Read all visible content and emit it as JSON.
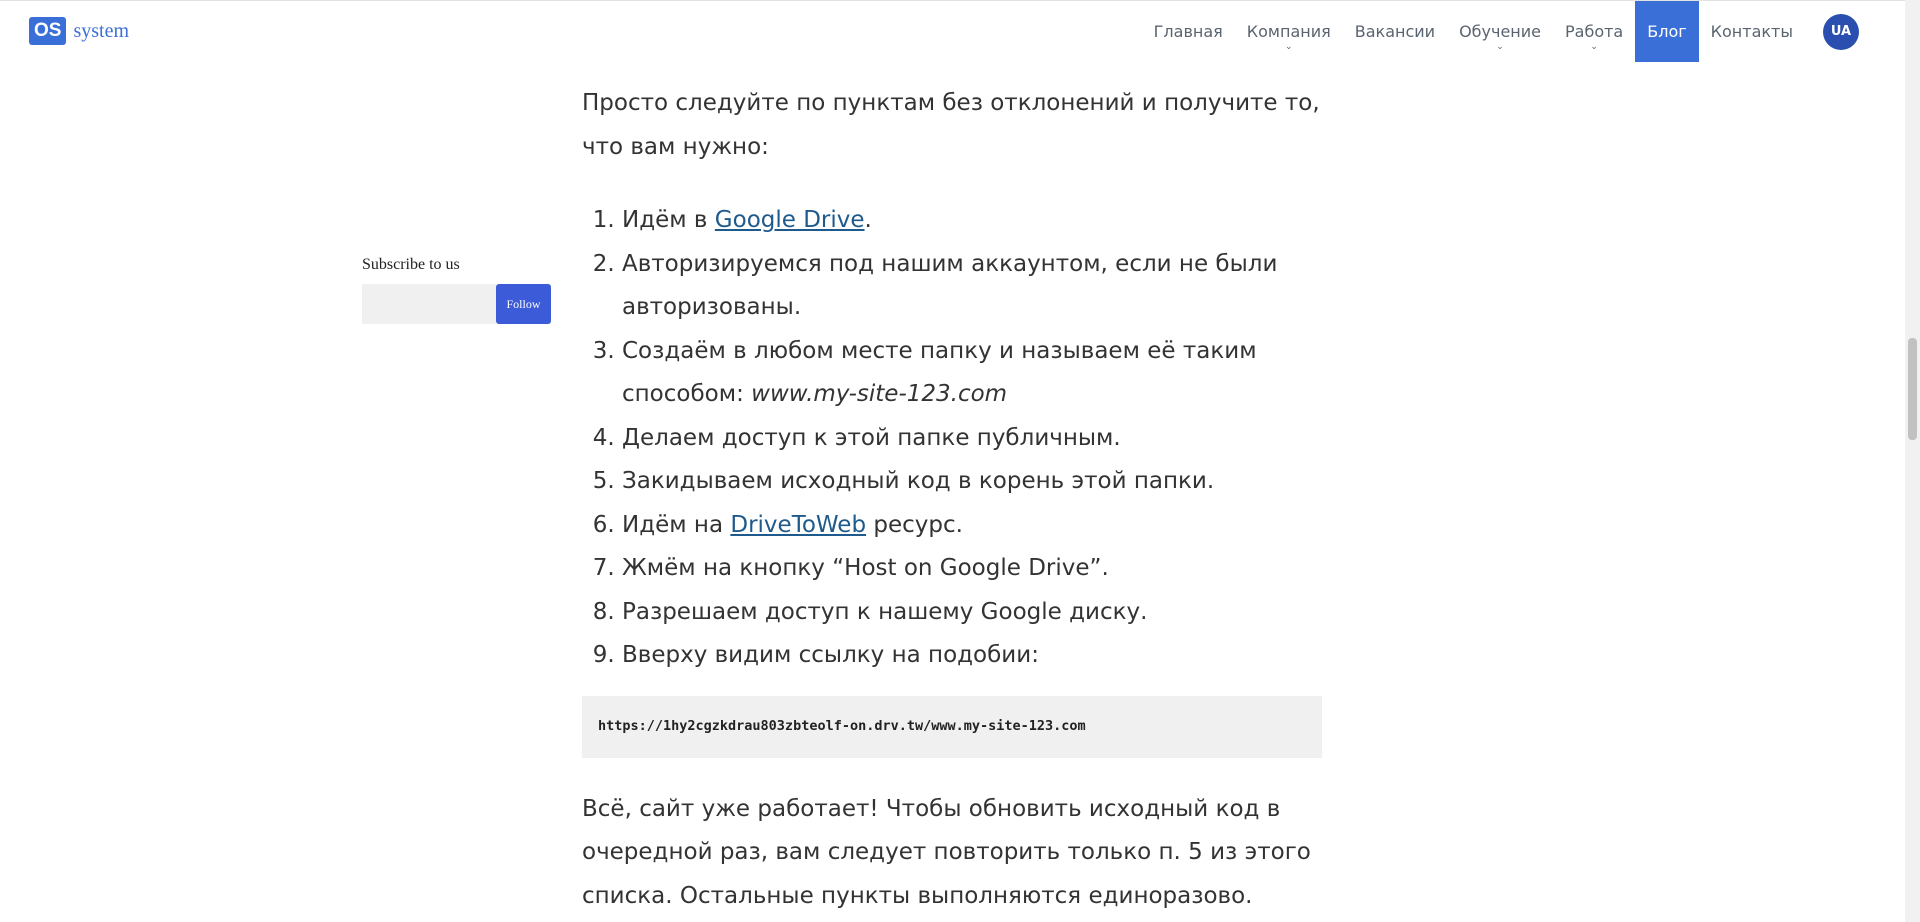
{
  "header": {
    "logo_badge": "OS",
    "logo_text": "system",
    "nav": [
      {
        "label": "Главная",
        "has_dropdown": false,
        "active": false
      },
      {
        "label": "Компания",
        "has_dropdown": true,
        "active": false
      },
      {
        "label": "Вакансии",
        "has_dropdown": false,
        "active": false
      },
      {
        "label": "Обучение",
        "has_dropdown": true,
        "active": false
      },
      {
        "label": "Работа",
        "has_dropdown": true,
        "active": false
      },
      {
        "label": "Блог",
        "has_dropdown": false,
        "active": true
      },
      {
        "label": "Контакты",
        "has_dropdown": false,
        "active": false
      }
    ],
    "language": "UA",
    "chevron_icon": "chevron-down-icon"
  },
  "sidebar": {
    "subscribe_title": "Subscribe to us",
    "subscribe_placeholder": "",
    "follow_label": "Follow"
  },
  "article": {
    "intro": "Просто следуйте по пунктам без отклонений и получите то, что вам нужно:",
    "steps": {
      "s1_before": "Идём в ",
      "s1_link": "Google Drive",
      "s1_after": ".",
      "s2": "Авторизируемся под нашим аккаунтом, если не были авторизованы.",
      "s3_before": "Создаём в любом месте папку и называем её таким способом: ",
      "s3_em": "www.my-site-123.com",
      "s4": "Делаем доступ к этой папке публичным.",
      "s5": "Закидываем исходный код в корень этой папки.",
      "s6_before": "Идём на ",
      "s6_link": "DriveToWeb",
      "s6_after": " ресурс.",
      "s7": "Жмём на кнопку “Host on Google Drive”.",
      "s8": "Разрешаем доступ к нашему Google диску.",
      "s9": "Вверху видим ссылку на подобии:"
    },
    "code": "https://1hy2cgzkdrau803zbteolf-on.drv.tw/www.my-site-123.com",
    "outro": "Всё, сайт уже работает! Чтобы обновить исходный код в очередной раз, вам следует повторить только п. 5 из этого списка. Остальные пункты выполняются единоразово."
  },
  "colors": {
    "brand": "#3b6fd8",
    "link": "#1f5a8c",
    "follow_button": "#3b5bd8",
    "language_badge": "#2a4fae"
  }
}
